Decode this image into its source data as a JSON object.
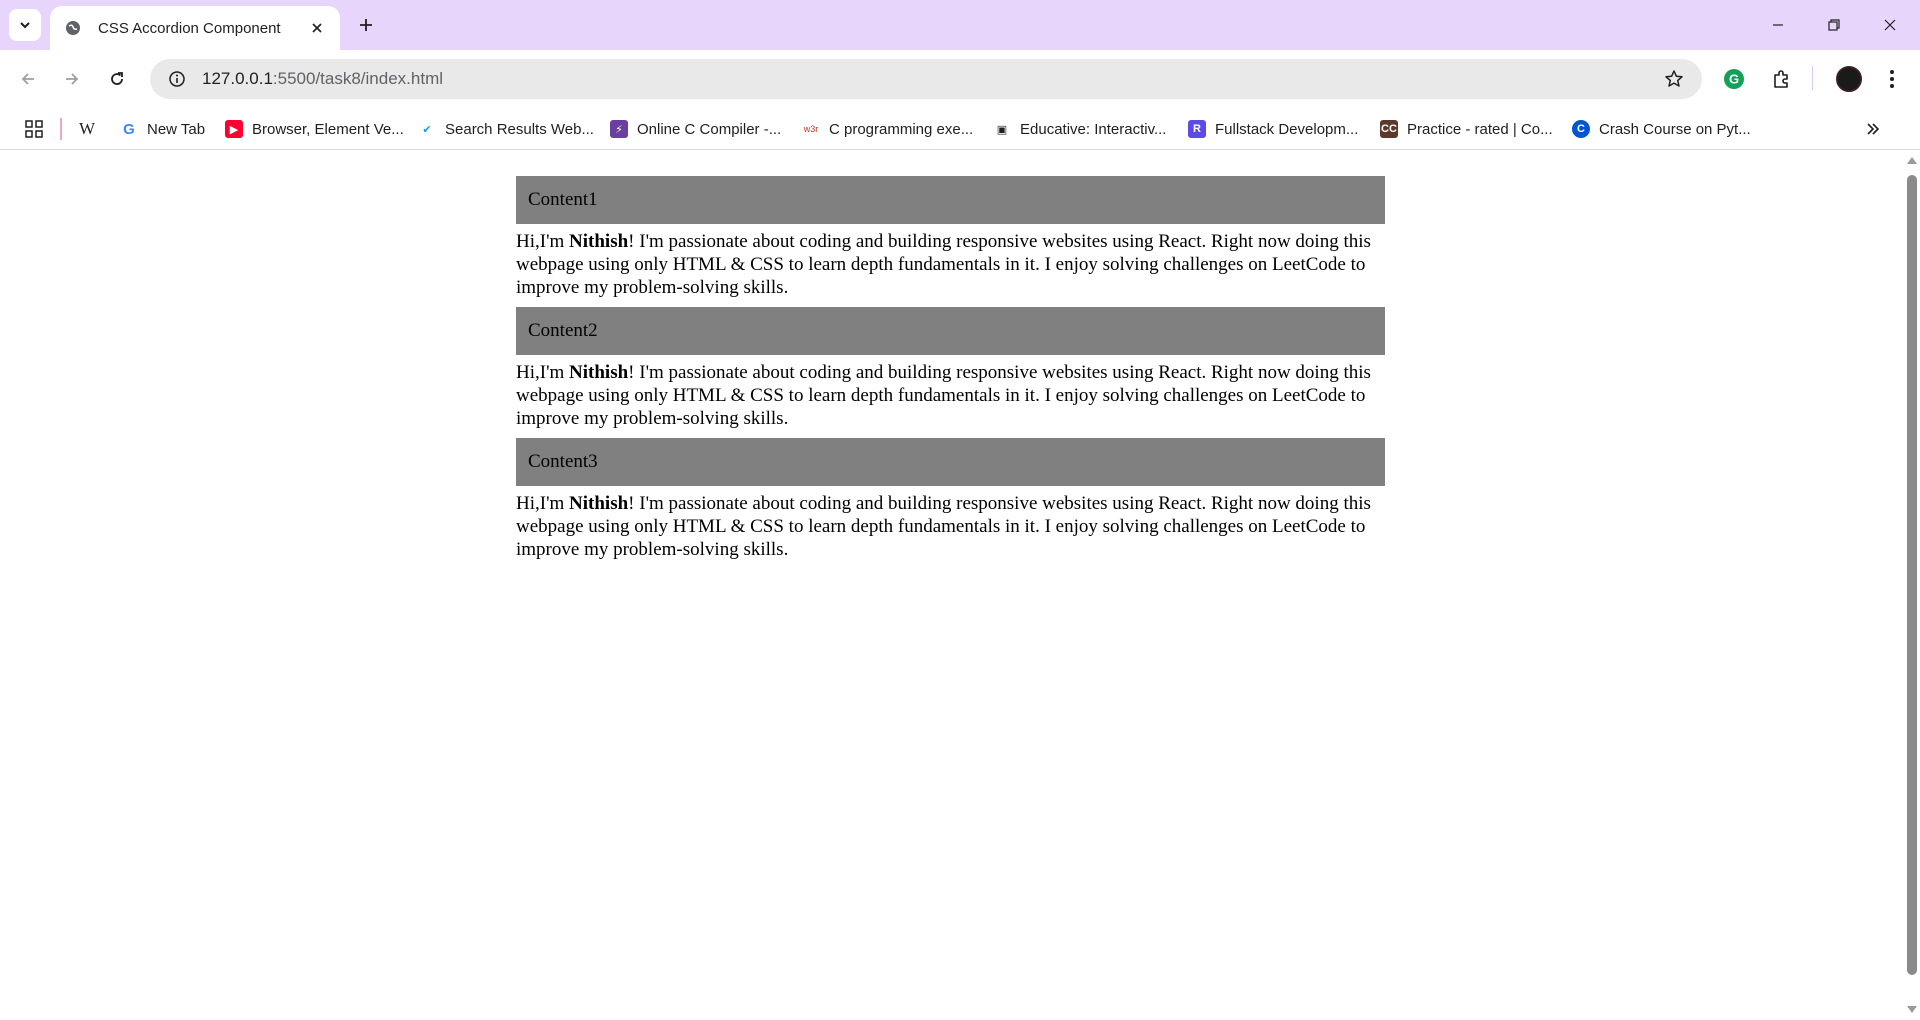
{
  "browser": {
    "tab": {
      "title": "CSS Accordion Component"
    },
    "url": {
      "host": "127.0.0.1",
      "rest": ":5500/task8/index.html"
    }
  },
  "bookmarks": [
    {
      "label": "",
      "icon": "wikipedia-icon",
      "glyph": "W",
      "color": "#1f1f1f",
      "bg": "transparent"
    },
    {
      "label": "New Tab",
      "icon": "google-icon",
      "glyph": "G",
      "color": "#4285f4",
      "bg": "transparent"
    },
    {
      "label": "Browser, Element Ve...",
      "icon": "youtube-icon",
      "glyph": "▶",
      "color": "#ffffff",
      "bg": "#ff0033"
    },
    {
      "label": "Search Results Web...",
      "icon": "checklist-icon",
      "glyph": "✔",
      "color": "#1a9be8",
      "bg": "transparent"
    },
    {
      "label": "Online C Compiler -...",
      "icon": "bolt-icon",
      "glyph": "⚡",
      "color": "#ffffff",
      "bg": "#6b3fa0"
    },
    {
      "label": "C programming exe...",
      "icon": "w3r-icon",
      "glyph": "w3r",
      "color": "#c0392b",
      "bg": "transparent"
    },
    {
      "label": "Educative: Interactiv...",
      "icon": "terminal-icon",
      "glyph": "▣",
      "color": "#1f1f1f",
      "bg": "transparent"
    },
    {
      "label": "Fullstack Developm...",
      "icon": "r-icon",
      "glyph": "R",
      "color": "#ffffff",
      "bg": "#5b4ce8"
    },
    {
      "label": "Practice - rated | Co...",
      "icon": "codechef-icon",
      "glyph": "CC",
      "color": "#ffffff",
      "bg": "#5b3a29"
    },
    {
      "label": "Crash Course on Pyt...",
      "icon": "coursera-icon",
      "glyph": "C",
      "color": "#ffffff",
      "bg": "#0056d2"
    }
  ],
  "accordion": [
    {
      "title": "Content1",
      "body": {
        "pre": "Hi,I'm ",
        "name": "Nithish",
        "post": "! I'm passionate about coding and building responsive websites using React. Right now doing this webpage using only HTML & CSS to learn depth fundamentals in it. I enjoy solving challenges on LeetCode to improve my problem-solving skills."
      }
    },
    {
      "title": "Content2",
      "body": {
        "pre": "Hi,I'm ",
        "name": "Nithish",
        "post": "! I'm passionate about coding and building responsive websites using React. Right now doing this webpage using only HTML & CSS to learn depth fundamentals in it. I enjoy solving challenges on LeetCode to improve my problem-solving skills."
      }
    },
    {
      "title": "Content3",
      "body": {
        "pre": "Hi,I'm ",
        "name": "Nithish",
        "post": "! I'm passionate about coding and building responsive websites using React. Right now doing this webpage using only HTML & CSS to learn depth fundamentals in it. I enjoy solving challenges on LeetCode to improve my problem-solving skills."
      }
    }
  ]
}
